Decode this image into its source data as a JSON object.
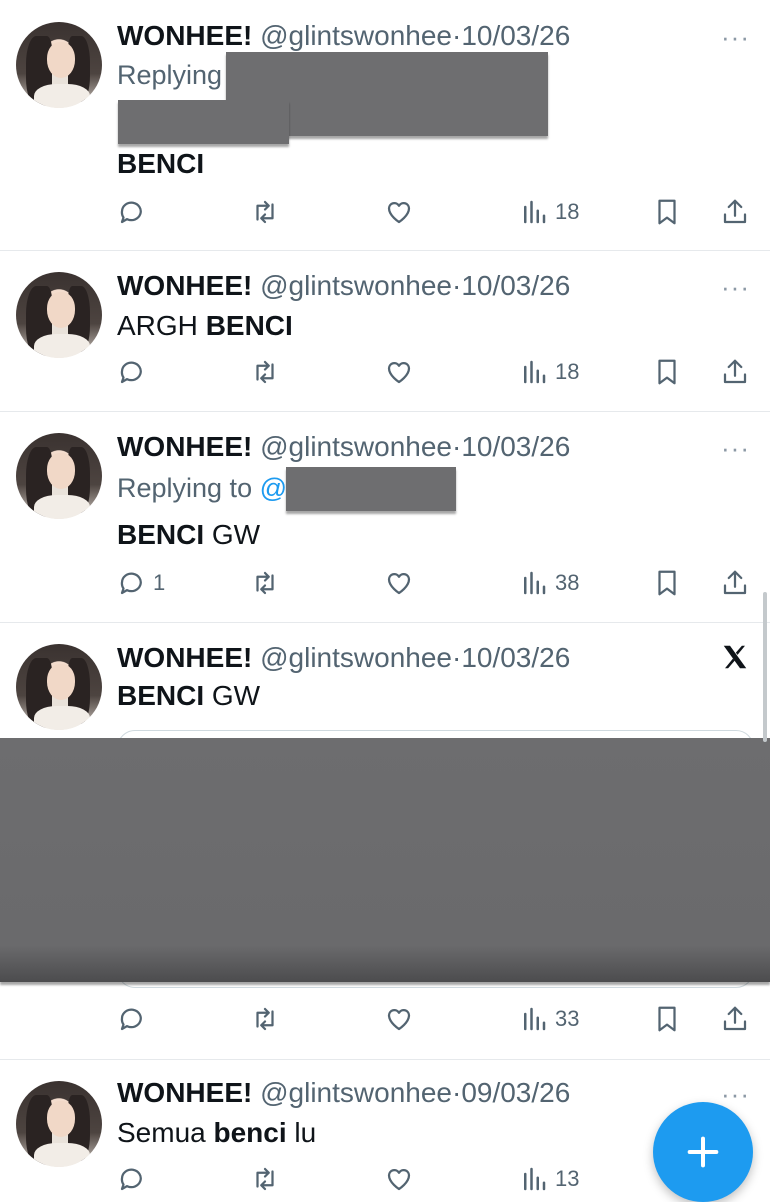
{
  "tweets": [
    {
      "name": "WONHEE!",
      "handle": "@glintswonhee",
      "date": "10/03/26",
      "replying_label": "Replying",
      "text_bold": "BENCI",
      "views": "18"
    },
    {
      "name": "WONHEE!",
      "handle": "@glintswonhee",
      "date": "10/03/26",
      "text_plain": "ARGH ",
      "text_bold": "BENCI",
      "views": "18"
    },
    {
      "name": "WONHEE!",
      "handle": "@glintswonhee",
      "date": "10/03/26",
      "replying_label": "Replying to ",
      "replying_at": "@",
      "text_bold": "BENCI",
      "text_plain": " GW",
      "replies": "1",
      "views": "38"
    },
    {
      "name": "WONHEE!",
      "handle": "@glintswonhee",
      "date": "10/03/26",
      "text_bold": "BENCI",
      "text_plain": " GW",
      "views": "33"
    },
    {
      "name": "WONHEE!",
      "handle": "@glintswonhee",
      "date": "09/03/26",
      "text_plain_before": "Semua ",
      "text_bold": "benci",
      "text_plain": " lu",
      "views": "13"
    }
  ],
  "separator": "·",
  "more_label": "···",
  "colors": {
    "accent": "#1d9bf0",
    "secondary_text": "#536471",
    "redaction": "#6e6e70"
  },
  "icons": [
    "reply-icon",
    "retweet-icon",
    "like-icon",
    "views-icon",
    "bookmark-icon",
    "share-icon",
    "x-logo-icon",
    "compose-plus-icon"
  ]
}
